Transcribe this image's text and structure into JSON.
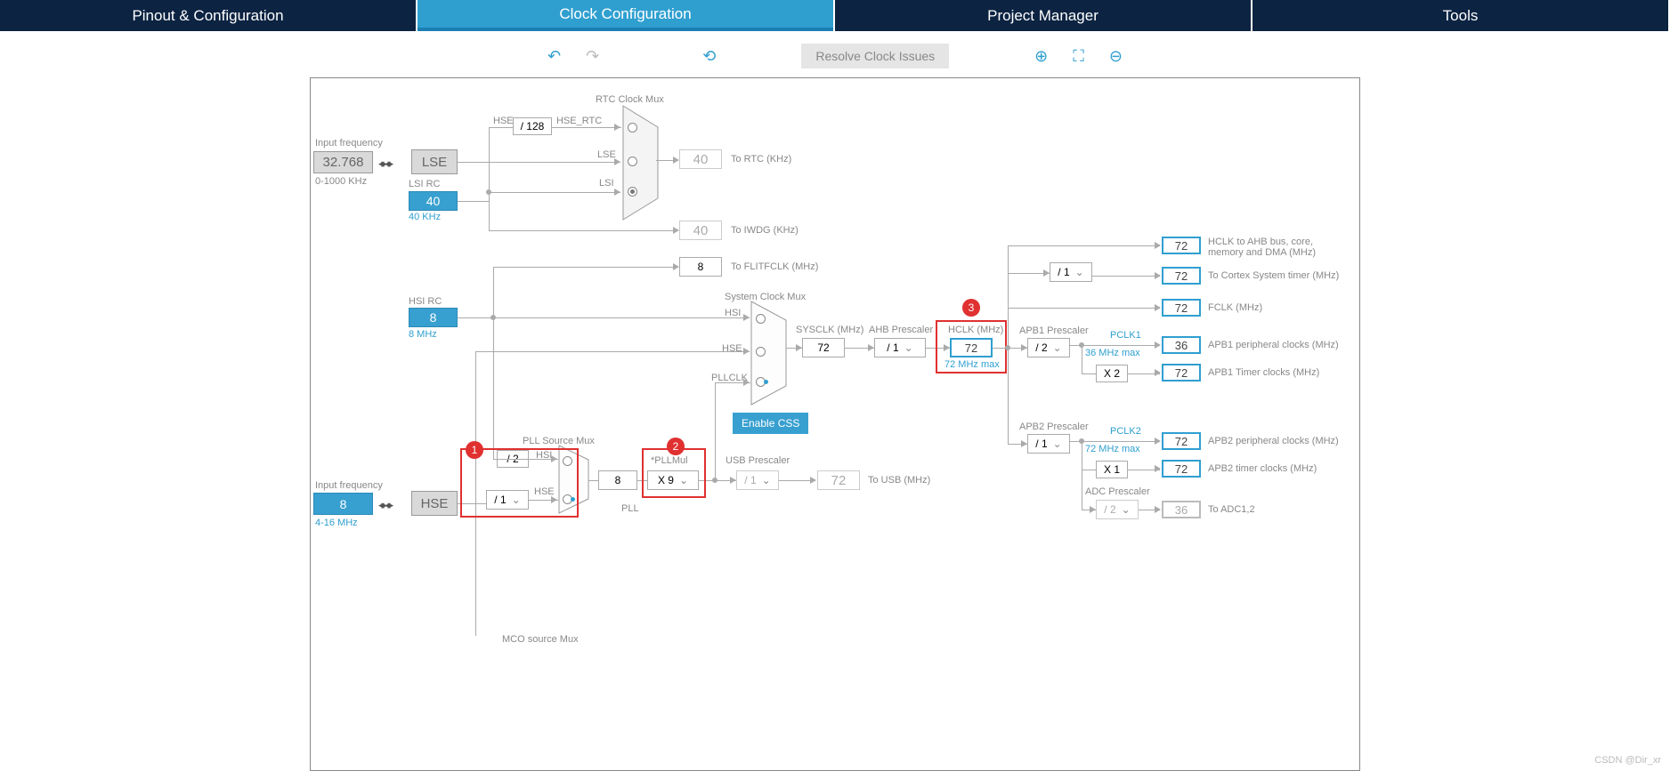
{
  "tabs": {
    "pinout": "Pinout & Configuration",
    "clock": "Clock Configuration",
    "project": "Project Manager",
    "tools": "Tools"
  },
  "toolbar": {
    "undo": "↶",
    "redo": "↷",
    "reset": "⟲",
    "resolve": "Resolve Clock Issues",
    "zoomin": "⊕",
    "fit": "⛶",
    "zoomout": "⊖"
  },
  "input_freq_label": "Input frequency",
  "lse": {
    "val": "32.768",
    "range": "0-1000 KHz",
    "name": "LSE"
  },
  "lsi": {
    "label": "LSI RC",
    "val": "40",
    "sub": "40 KHz"
  },
  "hsi": {
    "label": "HSI RC",
    "val": "8",
    "sub": "8 MHz"
  },
  "hse": {
    "label": "Input frequency",
    "val": "8",
    "range": "4-16 MHz",
    "name": "HSE"
  },
  "rtc": {
    "title": "RTC Clock Mux",
    "div": "/ 128",
    "sig_hse": "HSE",
    "sig_hsertc": "HSE_RTC",
    "sig_lse": "LSE",
    "sig_lsi": "LSI",
    "out": "40",
    "outlabel": "To RTC (KHz)"
  },
  "iwdg": {
    "out": "40",
    "label": "To IWDG (KHz)"
  },
  "flitf": {
    "out": "8",
    "label": "To FLITFCLK (MHz)"
  },
  "sysmux": {
    "title": "System Clock Mux",
    "hsi": "HSI",
    "hse": "HSE",
    "pllclk": "PLLCLK"
  },
  "sysclk": {
    "label": "SYSCLK (MHz)",
    "val": "72"
  },
  "ahb": {
    "label": "AHB Prescaler",
    "val": "/ 1"
  },
  "hclk": {
    "label": "HCLK (MHz)",
    "val": "72",
    "max": "72 MHz max"
  },
  "css": "Enable CSS",
  "pllsrc": {
    "title": "PLL Source Mux",
    "div2": "/ 2",
    "hsi": "HSI",
    "div1": "/ 1",
    "hse": "HSE",
    "pll": "PLL",
    "val": "8"
  },
  "pllmul": {
    "label": "*PLLMul",
    "val": "X 9"
  },
  "usb": {
    "label": "USB Prescaler",
    "div": "/ 1",
    "val": "72",
    "out": "To USB (MHz)"
  },
  "cortex": {
    "div": "/ 1"
  },
  "outputs": {
    "hclk_ahb": {
      "v": "72",
      "l": "HCLK to AHB bus, core,",
      "l2": "memory and DMA (MHz)"
    },
    "cortex": {
      "v": "72",
      "l": "To Cortex System timer (MHz)"
    },
    "fclk": {
      "v": "72",
      "l": "FCLK (MHz)"
    }
  },
  "apb1": {
    "label": "APB1 Prescaler",
    "div": "/ 2",
    "pclk": "PCLK1",
    "max": "36 MHz max",
    "periph": {
      "v": "36",
      "l": "APB1 peripheral clocks (MHz)"
    },
    "mul": "X 2",
    "timer": {
      "v": "72",
      "l": "APB1 Timer clocks (MHz)"
    }
  },
  "apb2": {
    "label": "APB2 Prescaler",
    "div": "/ 1",
    "pclk": "PCLK2",
    "max": "72 MHz max",
    "periph": {
      "v": "72",
      "l": "APB2 peripheral clocks (MHz)"
    },
    "mul": "X 1",
    "timer": {
      "v": "72",
      "l": "APB2 timer clocks (MHz)"
    }
  },
  "adc": {
    "label": "ADC Prescaler",
    "div": "/ 2",
    "v": "36",
    "l": "To ADC1,2"
  },
  "mco": "MCO source Mux",
  "annot": {
    "a1": "1",
    "a2": "2",
    "a3": "3"
  },
  "watermark": "CSDN @Dir_xr"
}
